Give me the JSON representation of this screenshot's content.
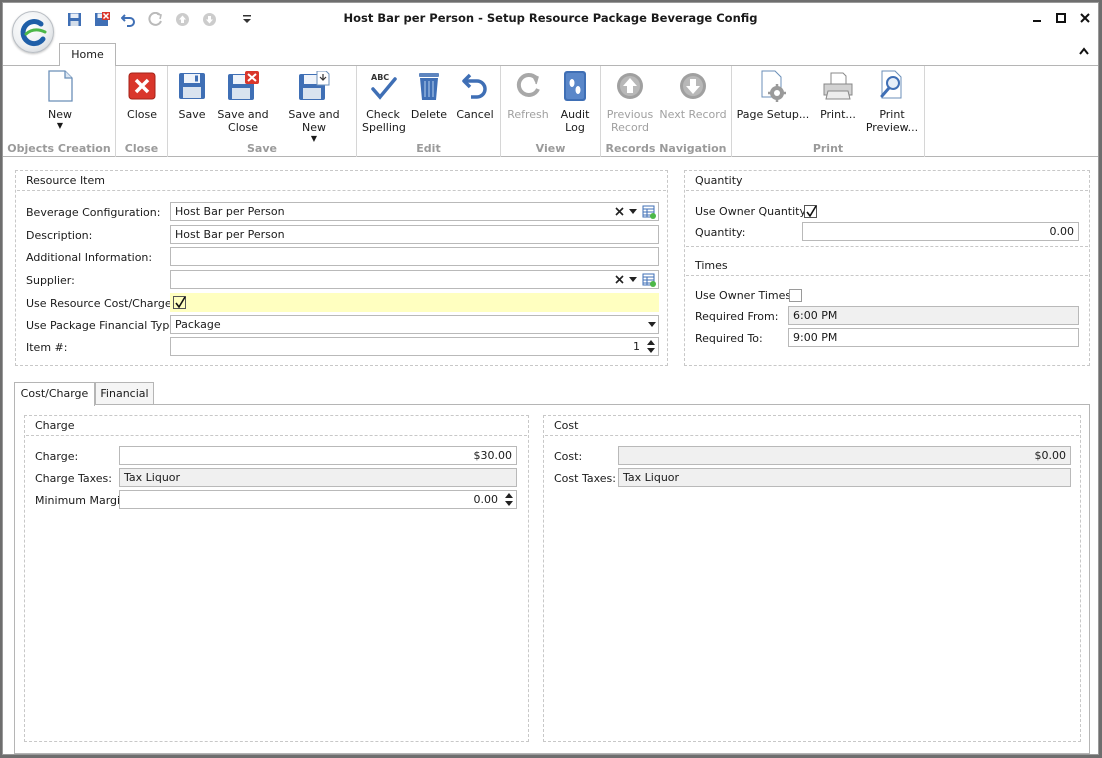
{
  "window": {
    "title": "Host Bar per Person - Setup Resource Package Beverage Config"
  },
  "ribbon": {
    "tabs": [
      {
        "label": "Home"
      }
    ],
    "groups": {
      "objects_creation": "Objects Creation",
      "close": "Close",
      "save": "Save",
      "edit": "Edit",
      "view": "View",
      "records_navigation": "Records Navigation",
      "print": "Print"
    },
    "buttons": {
      "new": "New",
      "close": "Close",
      "save": "Save",
      "save_close_1": "Save and",
      "save_close_2": "Close",
      "save_new": "Save and New",
      "check_spelling_1": "Check",
      "check_spelling_2": "Spelling",
      "abc": "ABC",
      "delete": "Delete",
      "cancel": "Cancel",
      "refresh": "Refresh",
      "audit_log_1": "Audit",
      "audit_log_2": "Log",
      "previous_record_1": "Previous",
      "previous_record_2": "Record",
      "next_record": "Next Record",
      "page_setup": "Page Setup...",
      "print": "Print...",
      "print_preview_1": "Print",
      "print_preview_2": "Preview..."
    }
  },
  "resource_item": {
    "title": "Resource Item",
    "beverage_configuration": {
      "label": "Beverage Configuration:",
      "value": "Host Bar per Person"
    },
    "description": {
      "label": "Description:",
      "value": "Host Bar per Person"
    },
    "additional_information": {
      "label": "Additional Information:",
      "value": ""
    },
    "supplier": {
      "label": "Supplier:",
      "value": ""
    },
    "use_resource_cost_charge": {
      "label": "Use Resource Cost/Charge:",
      "checked": true
    },
    "use_package_financial_type": {
      "label": "Use Package Financial Type:",
      "value": "Package"
    },
    "item_number": {
      "label": "Item #:",
      "value": "1"
    }
  },
  "quantity": {
    "title": "Quantity",
    "use_owner_quantity": {
      "label": "Use Owner Quantity:",
      "checked": true
    },
    "quantity": {
      "label": "Quantity:",
      "value": "0.00"
    }
  },
  "times": {
    "title": "Times",
    "use_owner_times": {
      "label": "Use Owner Times:",
      "checked": false
    },
    "required_from": {
      "label": "Required From:",
      "value": "6:00 PM"
    },
    "required_to": {
      "label": "Required To:",
      "value": "9:00 PM"
    }
  },
  "tabs": [
    {
      "label": "Cost/Charge",
      "active": true
    },
    {
      "label": "Financial",
      "active": false
    }
  ],
  "charge": {
    "title": "Charge",
    "charge": {
      "label": "Charge:",
      "value": "$30.00"
    },
    "charge_taxes": {
      "label": "Charge Taxes:",
      "value": "Tax Liquor"
    },
    "minimum_margin": {
      "label": "Minimum Margin:",
      "value": "0.00"
    }
  },
  "cost": {
    "title": "Cost",
    "cost": {
      "label": "Cost:",
      "value": "$0.00"
    },
    "cost_taxes": {
      "label": "Cost Taxes:",
      "value": "Tax Liquor"
    }
  },
  "colors": {
    "highlight_field": "#ffffc0",
    "close_red": "#d9362b",
    "save_blue": "#3f6fb5",
    "refresh_grey": "#a8a8a8"
  }
}
